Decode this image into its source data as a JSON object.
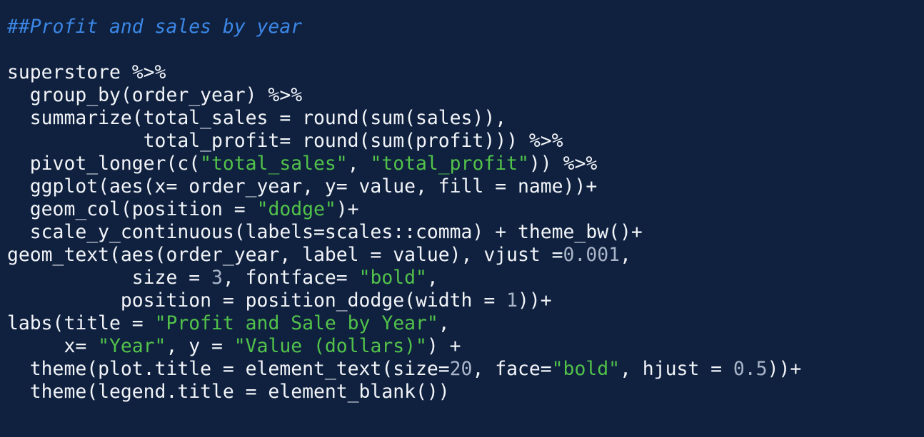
{
  "editor": {
    "background": "#0f213f",
    "colors": {
      "plain": "#f2f4f8",
      "comment": "#3c87e6",
      "string": "#52c24a",
      "number": "#aab4c8"
    },
    "lines": [
      [
        {
          "t": "comment",
          "v": "##Profit and sales by year"
        }
      ],
      [],
      [
        {
          "t": "plain",
          "v": "superstore %>%"
        }
      ],
      [
        {
          "t": "plain",
          "v": "  group_by(order_year) %>%"
        }
      ],
      [
        {
          "t": "plain",
          "v": "  summarize(total_sales = round(sum(sales)),"
        }
      ],
      [
        {
          "t": "plain",
          "v": "            total_profit= round(sum(profit))) %>%"
        }
      ],
      [
        {
          "t": "plain",
          "v": "  pivot_longer(c("
        },
        {
          "t": "string",
          "v": "\"total_sales\""
        },
        {
          "t": "plain",
          "v": ", "
        },
        {
          "t": "string",
          "v": "\"total_profit\""
        },
        {
          "t": "plain",
          "v": ")) %>%"
        }
      ],
      [
        {
          "t": "plain",
          "v": "  ggplot(aes(x= order_year, y= value, fill = name))+"
        }
      ],
      [
        {
          "t": "plain",
          "v": "  geom_col(position = "
        },
        {
          "t": "string",
          "v": "\"dodge\""
        },
        {
          "t": "plain",
          "v": ")+"
        }
      ],
      [
        {
          "t": "plain",
          "v": "  scale_y_continuous(labels=scales::comma) + theme_bw()+"
        }
      ],
      [
        {
          "t": "plain",
          "v": "geom_text(aes(order_year, label = value), vjust ="
        },
        {
          "t": "number",
          "v": "0.001"
        },
        {
          "t": "plain",
          "v": ","
        }
      ],
      [
        {
          "t": "plain",
          "v": "           size = "
        },
        {
          "t": "number",
          "v": "3"
        },
        {
          "t": "plain",
          "v": ", fontface= "
        },
        {
          "t": "string",
          "v": "\"bold\""
        },
        {
          "t": "plain",
          "v": ","
        }
      ],
      [
        {
          "t": "plain",
          "v": "          position = position_dodge(width = "
        },
        {
          "t": "number",
          "v": "1"
        },
        {
          "t": "plain",
          "v": "))+"
        }
      ],
      [
        {
          "t": "plain",
          "v": "labs(title = "
        },
        {
          "t": "string",
          "v": "\"Profit and Sale by Year\""
        },
        {
          "t": "plain",
          "v": ","
        }
      ],
      [
        {
          "t": "plain",
          "v": "     x= "
        },
        {
          "t": "string",
          "v": "\"Year\""
        },
        {
          "t": "plain",
          "v": ", y = "
        },
        {
          "t": "string",
          "v": "\"Value (dollars)\""
        },
        {
          "t": "plain",
          "v": ") +"
        }
      ],
      [
        {
          "t": "plain",
          "v": "  theme(plot.title = element_text(size="
        },
        {
          "t": "number",
          "v": "20"
        },
        {
          "t": "plain",
          "v": ", face="
        },
        {
          "t": "string",
          "v": "\"bold\""
        },
        {
          "t": "plain",
          "v": ", hjust = "
        },
        {
          "t": "number",
          "v": "0.5"
        },
        {
          "t": "plain",
          "v": "))+"
        }
      ],
      [
        {
          "t": "plain",
          "v": "  theme(legend.title = element_blank())"
        }
      ]
    ]
  }
}
